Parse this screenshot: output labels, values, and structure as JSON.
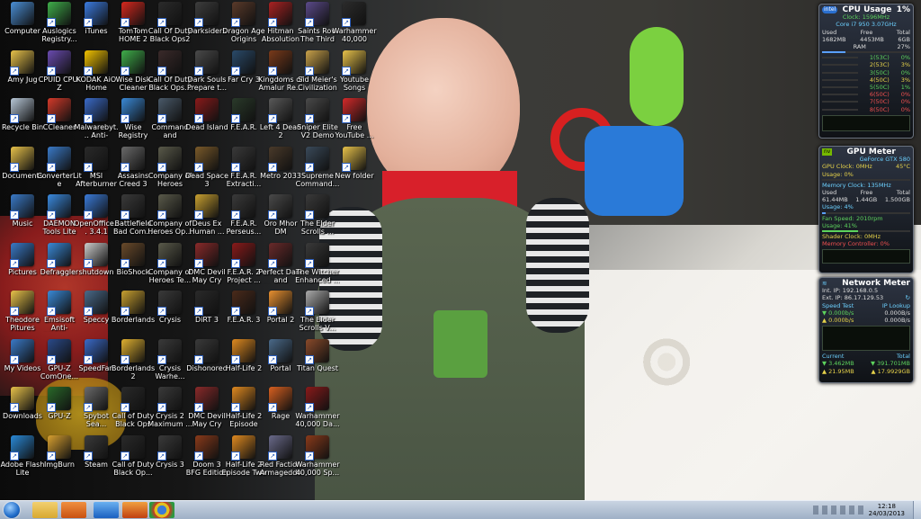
{
  "desktop": {
    "icons": [
      {
        "label": "Computer",
        "color": "#4a8fd6"
      },
      {
        "label": "Auslogics Registry...",
        "color": "#3fae4a"
      },
      {
        "label": "iTunes",
        "color": "#3b7be0"
      },
      {
        "label": "TomTom HOME 2",
        "color": "#d7281e"
      },
      {
        "label": "Call Of Duty Black Ops2",
        "color": "#2b2b2b"
      },
      {
        "label": "Darksiders",
        "color": "#3d3d3d"
      },
      {
        "label": "Dragon Age Origins",
        "color": "#5a3a2a"
      },
      {
        "label": "Hitman Absolution",
        "color": "#a22"
      },
      {
        "label": "Saints Row The Third",
        "color": "#5b4a8a"
      },
      {
        "label": "Warhammer 40,000 Daw...",
        "color": "#2b2b2b"
      },
      {
        "label": "Amy Jug",
        "color": "#e8c24a"
      },
      {
        "label": "CPUID CPU-Z",
        "color": "#6a4bb0"
      },
      {
        "label": "KODAK AiO Home Center",
        "color": "#f2c200"
      },
      {
        "label": "Wise Disk Cleaner Free",
        "color": "#3fae4a"
      },
      {
        "label": "Call Of Duty Black Ops...",
        "color": "#3a2a2a"
      },
      {
        "label": "Dark Souls Prepare t...",
        "color": "#4a4a4a"
      },
      {
        "label": "Far Cry 3",
        "color": "#2a4a6a"
      },
      {
        "label": "Kingdoms of Amalur Re...",
        "color": "#7a3a1a"
      },
      {
        "label": "Sid Meier's Civilization V",
        "color": "#c9a24a"
      },
      {
        "label": "Youtube Songs",
        "color": "#e8c24a"
      },
      {
        "label": "Recycle Bin",
        "color": "#b8c8d8"
      },
      {
        "label": "CCleaner",
        "color": "#d43a2a"
      },
      {
        "label": "Malwarebyt... Anti-Malware",
        "color": "#3a6ac8"
      },
      {
        "label": "Wise Registry Cleaner",
        "color": "#3a8ad8"
      },
      {
        "label": "Command and Conqu...",
        "color": "#4a5a6a"
      },
      {
        "label": "Dead Island",
        "color": "#8a1a1a"
      },
      {
        "label": "F.E.A.R.",
        "color": "#2a3a2a"
      },
      {
        "label": "Left 4 Dead 2",
        "color": "#5a5a5a"
      },
      {
        "label": "Sniper Elite V2 Demo",
        "color": "#4a4a4a"
      },
      {
        "label": "Free YouTube ...",
        "color": "#d42a2a"
      },
      {
        "label": "Documents",
        "color": "#e8c24a"
      },
      {
        "label": "ConverterLite",
        "color": "#3a7ac8"
      },
      {
        "label": "MSI Afterburner",
        "color": "#2a2a2a"
      },
      {
        "label": "Assasins Creed 3",
        "color": "#6a6a6a"
      },
      {
        "label": "Company of Heroes",
        "color": "#5a5a4a"
      },
      {
        "label": "Dead Space 3",
        "color": "#7a5a2a"
      },
      {
        "label": "F.E.A.R. Extracti...",
        "color": "#3a3a3a"
      },
      {
        "label": "Metro 2033",
        "color": "#4a3a2a"
      },
      {
        "label": "Supreme Command...",
        "color": "#3a4a5a"
      },
      {
        "label": "New folder",
        "color": "#e8c24a"
      },
      {
        "label": "Music",
        "color": "#3a7ac8"
      },
      {
        "label": "DAEMON Tools Lite",
        "color": "#3a8ae0"
      },
      {
        "label": "OpenOffice... 3.4.1",
        "color": "#3a7ad8"
      },
      {
        "label": "Battlefield Bad Com...",
        "color": "#3a3a3a"
      },
      {
        "label": "Company of Heroes Op...",
        "color": "#5a5a4a"
      },
      {
        "label": "Deus Ex Human ...",
        "color": "#c8a030"
      },
      {
        "label": "F.E.A.R. Perseus...",
        "color": "#3a3a3a"
      },
      {
        "label": "Oro Mhor DM",
        "color": "#4a4a4a"
      },
      {
        "label": "The Elder Scrolls ...",
        "color": "#3a3a3a"
      },
      {
        "label": "Pictures",
        "color": "#3a7ac8"
      },
      {
        "label": "Defraggler",
        "color": "#3a8ad8"
      },
      {
        "label": "shutdown",
        "color": "#cccccc"
      },
      {
        "label": "BioShock",
        "color": "#6a4a2a"
      },
      {
        "label": "Company of Heroes Te...",
        "color": "#5a5a4a"
      },
      {
        "label": "DMC Devil May Cry",
        "color": "#8a2a2a"
      },
      {
        "label": "F.E.A.R. 2 Project ...",
        "color": "#8a1a1a"
      },
      {
        "label": "Perfect Dark and Obsession",
        "color": "#6a2a2a"
      },
      {
        "label": "The Witcher Enhanced ...",
        "color": "#3a3a3a"
      },
      {
        "label": "Theodore Pitures",
        "color": "#e8c24a"
      },
      {
        "label": "Emsisoft Anti-Malware",
        "color": "#3a8ad8"
      },
      {
        "label": "Speccy",
        "color": "#4a6a8a"
      },
      {
        "label": "Borderlands",
        "color": "#c8a030"
      },
      {
        "label": "Crysis",
        "color": "#3a3a3a"
      },
      {
        "label": "DiRT 3",
        "color": "#2a2a2a"
      },
      {
        "label": "F.E.A.R. 3",
        "color": "#4a2a1a"
      },
      {
        "label": "Portal 2",
        "color": "#e89030"
      },
      {
        "label": "The Elder Scrolls V...",
        "color": "#aaaaaa"
      },
      {
        "label": "My Videos",
        "color": "#3a7ac8"
      },
      {
        "label": "GPU-Z ComOne...",
        "color": "#2a4a8a"
      },
      {
        "label": "SpeedFan",
        "color": "#3a6ac8"
      },
      {
        "label": "Borderlands 2",
        "color": "#e0b030"
      },
      {
        "label": "Crysis Warhe...",
        "color": "#3a3a3a"
      },
      {
        "label": "Dishonored",
        "color": "#3a3a3a"
      },
      {
        "label": "Half-Life 2",
        "color": "#e08a20"
      },
      {
        "label": "Portal",
        "color": "#4a6a8a"
      },
      {
        "label": "Titan Quest",
        "color": "#8a4a2a"
      },
      {
        "label": "Downloads",
        "color": "#e8c24a"
      },
      {
        "label": "GPU-Z",
        "color": "#2a6a2a"
      },
      {
        "label": "Spybot Sea...",
        "color": "#6a6a6a"
      },
      {
        "label": "Call of Duty Black Ops",
        "color": "#2a2a2a"
      },
      {
        "label": "Crysis 2 Maximum ...",
        "color": "#3a3a3a"
      },
      {
        "label": "DMC Devil May Cry",
        "color": "#8a2a2a"
      },
      {
        "label": "Half-Life 2 Episode One",
        "color": "#e08a20"
      },
      {
        "label": "Rage",
        "color": "#d86020"
      },
      {
        "label": "Warhammer 40,000 Da...",
        "color": "#8a1a1a"
      },
      {
        "label": "Adobe Flash Lite",
        "color": "#2a8ad8"
      },
      {
        "label": "ImgBurn",
        "color": "#d8a030"
      },
      {
        "label": "Steam",
        "color": "#3a3a3a"
      },
      {
        "label": "Call of Duty Black Op...",
        "color": "#2a2a2a"
      },
      {
        "label": "Crysis 3",
        "color": "#3a3a3a"
      },
      {
        "label": "Doom 3 BFG Edition",
        "color": "#8a3a1a"
      },
      {
        "label": "Half-Life 2 Episode Two",
        "color": "#e08a20"
      },
      {
        "label": "Red Faction Armageddon",
        "color": "#6a6a8a"
      },
      {
        "label": "Warhammer 40,000 Sp...",
        "color": "#8a3a1a"
      }
    ]
  },
  "cpu_gadget": {
    "title": "CPU Usage",
    "percent": "1%",
    "clock": "Clock: 1596MHz",
    "model": "Core i7 950 3.07GHz",
    "used_label": "Used",
    "free_label": "Free",
    "total_label": "Total",
    "used": "1682MB",
    "free": "4453MB",
    "total": "6GB",
    "ram_label": "RAM",
    "ram_pct": "27%",
    "cores": [
      {
        "name": "1(53C)",
        "pct": "0%",
        "color": "#5dd35d"
      },
      {
        "name": "2(53C)",
        "pct": "3%",
        "color": "#e6d24a"
      },
      {
        "name": "3(50C)",
        "pct": "0%",
        "color": "#5dd35d"
      },
      {
        "name": "4(50C)",
        "pct": "3%",
        "color": "#e6d24a"
      },
      {
        "name": "5(50C)",
        "pct": "1%",
        "color": "#5dd35d"
      },
      {
        "name": "6(50C)",
        "pct": "0%",
        "color": "#f05050"
      },
      {
        "name": "7(50C)",
        "pct": "0%",
        "color": "#f05050"
      },
      {
        "name": "8(50C)",
        "pct": "0%",
        "color": "#f05050"
      }
    ]
  },
  "gpu_gadget": {
    "title": "GPU Meter",
    "card": "GeForce GTX 580",
    "clock": "GPU Clock: 0MHz",
    "temp": "45°C",
    "usage": "Usage: 0%",
    "mem_clock": "Memory Clock: 135MHz",
    "used_label": "Used",
    "free_label": "Free",
    "total_label": "Total",
    "used": "61.44MB",
    "free": "1.44GB",
    "total": "1.500GB",
    "mem_usage": "Usage: 4%",
    "fan": "Fan Speed: 2010rpm",
    "fan_usage": "Usage: 41%",
    "shader": "Shader Clock: 0MHz",
    "mem_ctrl": "Memory Controller: 0%"
  },
  "net_gadget": {
    "title": "Network Meter",
    "int_ip": "Int. IP: 192.168.0.5",
    "ext_ip": "Ext. IP: 86.17.129.53",
    "speed_test": "Speed Test",
    "ip_lookup": "IP Lookup",
    "down1": "0.000b/s",
    "down2": "0.000B/s",
    "up1": "0.000b/s",
    "up2": "0.000B/s",
    "current": "Current",
    "total": "Total",
    "cur_down": "3.462MB",
    "tot_down": "391.701MB",
    "cur_up": "21.95MB",
    "tot_up": "17.9929GB"
  },
  "taskbar": {
    "time": "12:18",
    "date": "24/03/2013"
  }
}
